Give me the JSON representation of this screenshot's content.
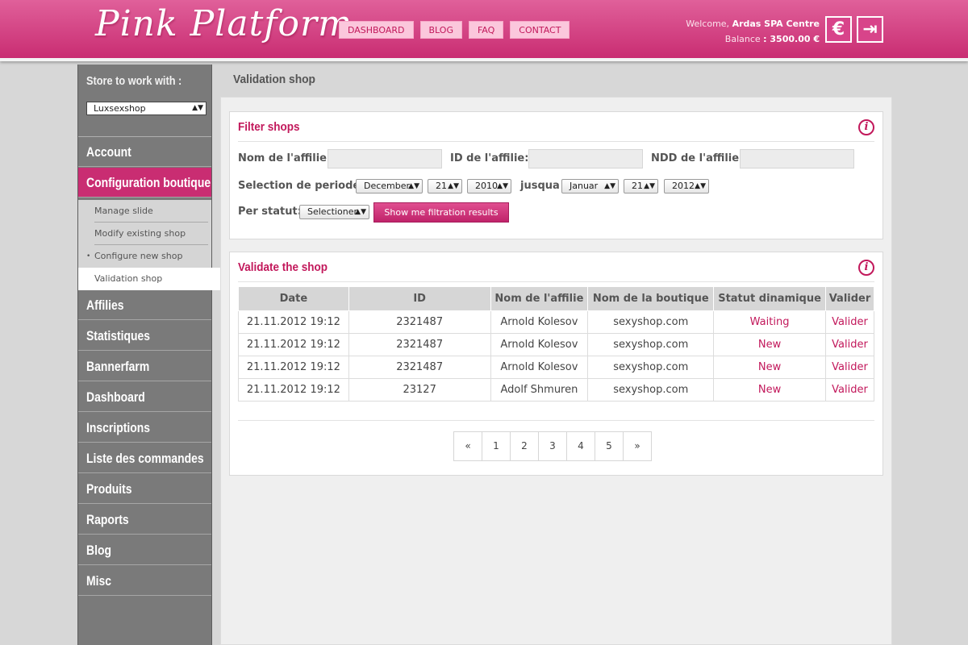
{
  "header": {
    "logo": "Pink Platform",
    "nav": [
      "DASHBOARD",
      "BLOG",
      "FAQ",
      "CONTACT"
    ],
    "welcome_prefix": "Welcome,",
    "user_name": "Ardas SPA Centre",
    "balance_label": "Balance",
    "balance_value": ": 3500.00 €",
    "euro_icon": "€",
    "logout_icon": "⇥"
  },
  "sidebar": {
    "store_label": "Store to work with :",
    "store_selected": "Luxsexshop",
    "menu": [
      "Account",
      "Configuration boutique",
      "Affilies",
      "Statistiques",
      "Bannerfarm",
      "Dashboard",
      "Inscriptions",
      "Liste des commandes",
      "Produits",
      "Raports",
      "Blog",
      "Misc"
    ],
    "submenu": [
      "Manage slide",
      "Modify existing shop",
      "Configure new shop",
      "Validation shop"
    ],
    "submenu_bullet": "•"
  },
  "main": {
    "page_title": "Validation shop",
    "filter": {
      "title": "Filter shops",
      "label_nom": "Nom de l'affilie:",
      "label_id": "ID de l'affilie:",
      "label_ndd": "NDD de l'affilie:",
      "label_periode": "Selection de periode:",
      "from_month": "December",
      "from_day": "21",
      "from_year": "2010",
      "label_jusqua": "jusqua",
      "to_month": "Januar",
      "to_day": "21",
      "to_year": "2012",
      "label_statut": "Per statut:",
      "statut_selected": "Selectioner",
      "button": "Show me filtration results"
    },
    "validate": {
      "title": "Validate the shop",
      "columns": [
        "Date",
        "ID",
        "Nom de l'affilie",
        "Nom de la boutique",
        "Statut dinamique",
        "Valider"
      ],
      "rows": [
        [
          "21.11.2012 19:12",
          "2321487",
          "Arnold Kolesov",
          "sexyshop.com",
          "Waiting",
          "Valider"
        ],
        [
          "21.11.2012 19:12",
          "2321487",
          "Arnold Kolesov",
          "sexyshop.com",
          "New",
          "Valider"
        ],
        [
          "21.11.2012 19:12",
          "2321487",
          "Arnold Kolesov",
          "sexyshop.com",
          "New",
          "Valider"
        ],
        [
          "21.11.2012 19:12",
          "23127",
          "Adolf Shmuren",
          "sexyshop.com",
          "New",
          "Valider"
        ]
      ],
      "pager": [
        "«",
        "1",
        "2",
        "3",
        "4",
        "5",
        "»"
      ]
    }
  },
  "colors": {
    "brand_pink": "#c92d72",
    "sidebar_gray": "#7a7a7a"
  }
}
